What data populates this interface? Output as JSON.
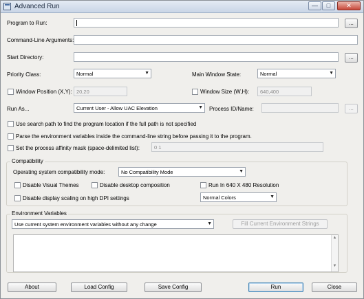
{
  "window": {
    "title": "Advanced Run",
    "min_glyph": "—",
    "max_glyph": "□",
    "close_glyph": "✕"
  },
  "program": {
    "label": "Program to Run:",
    "value": "",
    "browse": "..."
  },
  "cmdline": {
    "label": "Command-Line Arguments:",
    "value": ""
  },
  "startdir": {
    "label": "Start Directory:",
    "value": "",
    "browse": "..."
  },
  "priority": {
    "label": "Priority Class:",
    "value": "Normal"
  },
  "mainwin": {
    "label": "Main Window State:",
    "value": "Normal"
  },
  "winpos": {
    "label": "Window Position (X,Y):",
    "value": "20,20",
    "checked": false
  },
  "winsize": {
    "label": "Window Size (W,H):",
    "value": "640,400",
    "checked": false
  },
  "runas": {
    "label": "Run As...",
    "value": "Current User - Allow UAC Elevation",
    "pid_label": "Process ID/Name:",
    "pid_value": "",
    "browse": "..."
  },
  "options": {
    "search_path": "Use search path to find the program location if the full path is not specified",
    "parse_env": "Parse the environment variables inside the command-line string before passing it to the program.",
    "affinity": "Set the process affinity mask (space-delimited list):",
    "affinity_value": "0 1"
  },
  "compat": {
    "group_title": "Compatibility",
    "mode_label": "Operating system compatibility mode:",
    "mode_value": "No Compatibility Mode",
    "visual_themes": "Disable Visual Themes",
    "desktop_comp": "Disable desktop composition",
    "run640": "Run In 640 X 480 Resolution",
    "dpi_scaling": "Disable display scaling on high DPI settings",
    "colors_value": "Normal Colors"
  },
  "env": {
    "group_title": "Environment Variables",
    "mode_value": "Use current system environment variables without any change",
    "fill_button": "Fill Current Environment Strings",
    "scroll_up": "▲",
    "scroll_down": "▼"
  },
  "buttons": {
    "about": "About",
    "load": "Load Config",
    "save": "Save Config",
    "run": "Run",
    "close": "Close"
  },
  "glyphs": {
    "dropdown": "▼"
  }
}
